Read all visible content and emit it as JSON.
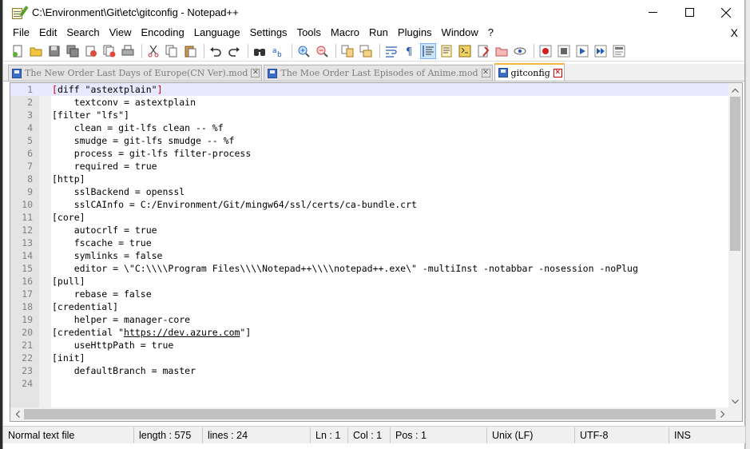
{
  "window": {
    "title": "C:\\Environment\\Git\\etc\\gitconfig - Notepad++"
  },
  "menu": {
    "items": [
      "File",
      "Edit",
      "Search",
      "View",
      "Encoding",
      "Language",
      "Settings",
      "Tools",
      "Macro",
      "Run",
      "Plugins",
      "Window",
      "?"
    ],
    "close_doc": "X"
  },
  "toolbar": {
    "buttons": [
      "new-file",
      "open-file",
      "save",
      "save-all",
      "close",
      "close-all",
      "print",
      "cut",
      "copy",
      "paste",
      "undo",
      "redo",
      "find",
      "replace",
      "zoom-in",
      "zoom-out",
      "sync-vertical",
      "sync-horizontal",
      "word-wrap",
      "show-all-chars",
      "indent-guide",
      "udl",
      "doc-map",
      "function-list",
      "folder-workspace",
      "monitoring",
      "record-macro",
      "stop-macro",
      "play-macro",
      "run-macro-multiple",
      "save-macro"
    ],
    "active": "indent-guide"
  },
  "tabs": [
    {
      "label": "The New Order Last Days of Europe(CN Ver).mod",
      "active": false
    },
    {
      "label": "The Moe Order Last Episodes of Anime.mod",
      "active": false
    },
    {
      "label": "gitconfig",
      "active": true
    }
  ],
  "editor": {
    "lines": [
      {
        "n": "1",
        "text": "[diff \"astextplain\"]"
      },
      {
        "n": "2",
        "text": "    textconv = astextplain"
      },
      {
        "n": "3",
        "text": "[filter \"lfs\"]"
      },
      {
        "n": "4",
        "text": "    clean = git-lfs clean -- %f"
      },
      {
        "n": "5",
        "text": "    smudge = git-lfs smudge -- %f"
      },
      {
        "n": "6",
        "text": "    process = git-lfs filter-process"
      },
      {
        "n": "7",
        "text": "    required = true"
      },
      {
        "n": "8",
        "text": "[http]"
      },
      {
        "n": "9",
        "text": "    sslBackend = openssl"
      },
      {
        "n": "10",
        "text": "    sslCAInfo = C:/Environment/Git/mingw64/ssl/certs/ca-bundle.crt"
      },
      {
        "n": "11",
        "text": "[core]"
      },
      {
        "n": "12",
        "text": "    autocrlf = true"
      },
      {
        "n": "13",
        "text": "    fscache = true"
      },
      {
        "n": "14",
        "text": "    symlinks = false"
      },
      {
        "n": "15",
        "text": "    editor = \\\"C:\\\\\\\\Program Files\\\\\\\\Notepad++\\\\\\\\notepad++.exe\\\" -multiInst -notabbar -nosession -noPlug"
      },
      {
        "n": "16",
        "text": "[pull]"
      },
      {
        "n": "17",
        "text": "    rebase = false"
      },
      {
        "n": "18",
        "text": "[credential]"
      },
      {
        "n": "19",
        "text": "    helper = manager-core"
      },
      {
        "n": "20",
        "text": "[credential \"https://dev.azure.com\"]"
      },
      {
        "n": "21",
        "text": "    useHttpPath = true"
      },
      {
        "n": "22",
        "text": "[init]"
      },
      {
        "n": "23",
        "text": "    defaultBranch = master"
      },
      {
        "n": "24",
        "text": ""
      }
    ],
    "current_line": 1
  },
  "status": {
    "file_type": "Normal text file",
    "length": "length : 575",
    "lines": "lines : 24",
    "ln": "Ln : 1",
    "col": "Col : 1",
    "pos": "Pos : 1",
    "eol": "Unix (LF)",
    "encoding": "UTF-8",
    "mode": "INS"
  }
}
